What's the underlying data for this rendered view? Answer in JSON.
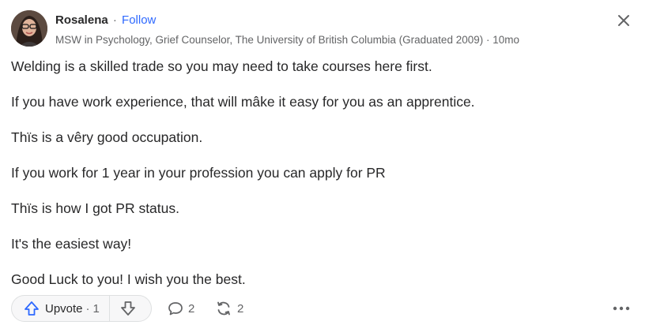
{
  "author": {
    "name": "Rosalena",
    "separator": "·",
    "follow_label": "Follow",
    "credential": "MSW in Psychology, Grief Counselor, The University of British Columbia (Graduated 2009)",
    "time_separator": "·",
    "time": "10mo"
  },
  "answer": {
    "paragraphs": [
      "Welding is a skilled trade so you may need to take courses here first.",
      "If you have work experience, that will mâke it easy for you as an apprentice.",
      "Thïs is a vêry good occupation.",
      "If you work for 1 year in your profession you can apply for PR",
      "Thïs is how I got PR status.",
      "It's the easiest way!",
      "Good Luck to you! I wish you the best."
    ]
  },
  "actions": {
    "upvote_label": "Upvote",
    "upvote_separator": "·",
    "upvote_count": "1",
    "comment_count": "2",
    "share_count": "2"
  },
  "icons": {
    "close": "close-icon",
    "upvote": "arrow-up-icon",
    "downvote": "arrow-down-icon",
    "comment": "comment-icon",
    "share": "share-icon",
    "more": "more-icon"
  },
  "colors": {
    "accent": "#2e69ff",
    "text": "#282829",
    "muted": "#636466",
    "upvote_icon": "#2e69ff"
  }
}
